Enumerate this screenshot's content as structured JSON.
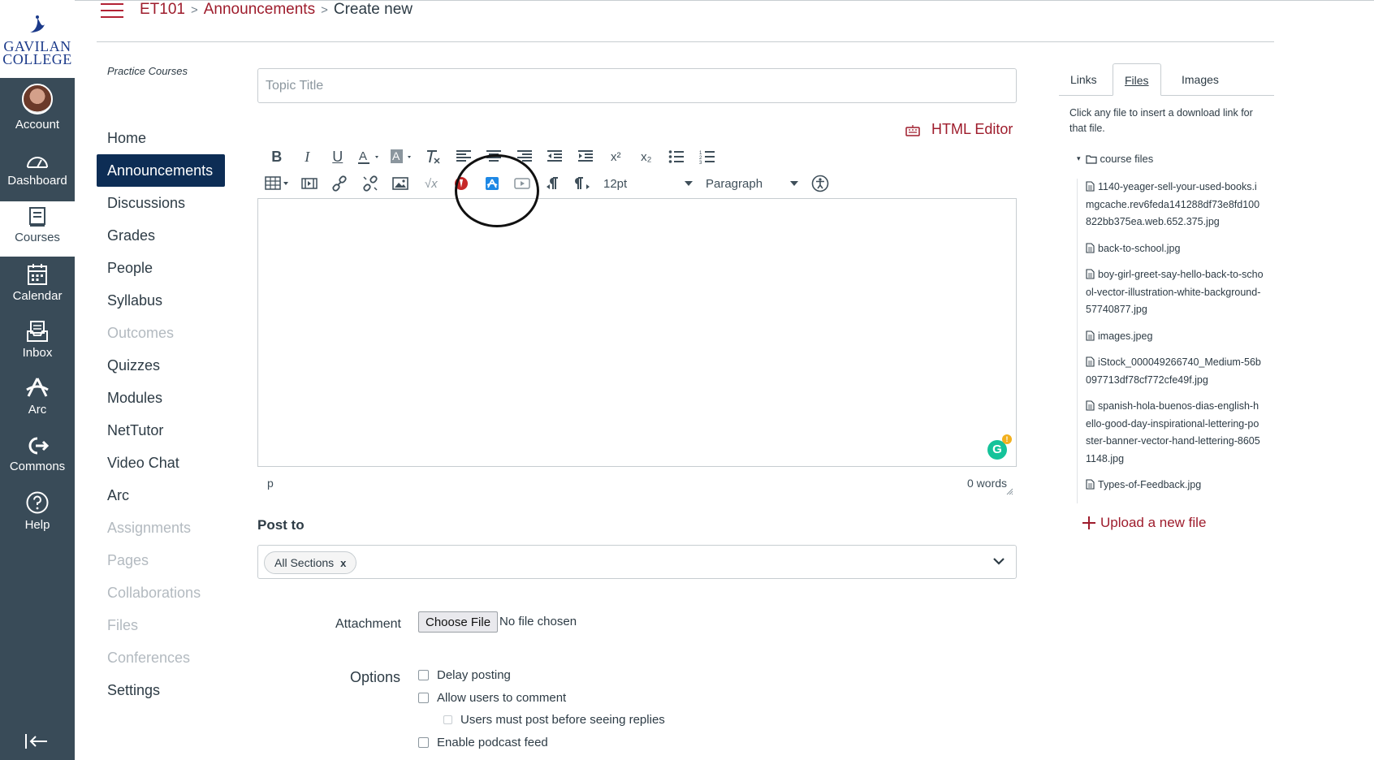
{
  "global_nav": {
    "logo_line1": "GAVILAN",
    "logo_line2": "COLLEGE",
    "items": [
      {
        "label": "Account",
        "icon": "avatar"
      },
      {
        "label": "Dashboard",
        "icon": "dashboard-icon"
      },
      {
        "label": "Courses",
        "icon": "courses-icon"
      },
      {
        "label": "Calendar",
        "icon": "calendar-icon"
      },
      {
        "label": "Inbox",
        "icon": "inbox-icon"
      },
      {
        "label": "Arc",
        "icon": "arc-icon"
      },
      {
        "label": "Commons",
        "icon": "commons-icon"
      },
      {
        "label": "Help",
        "icon": "help-icon"
      }
    ]
  },
  "breadcrumb": {
    "course": "ET101",
    "section": "Announcements",
    "current": "Create new",
    "separator": ">"
  },
  "course_nav": {
    "title": "Practice Courses",
    "items": [
      {
        "label": "Home"
      },
      {
        "label": "Announcements"
      },
      {
        "label": "Discussions"
      },
      {
        "label": "Grades"
      },
      {
        "label": "People"
      },
      {
        "label": "Syllabus"
      },
      {
        "label": "Outcomes"
      },
      {
        "label": "Quizzes"
      },
      {
        "label": "Modules"
      },
      {
        "label": "NetTutor"
      },
      {
        "label": "Video Chat"
      },
      {
        "label": "Arc"
      },
      {
        "label": "Assignments"
      },
      {
        "label": "Pages"
      },
      {
        "label": "Collaborations"
      },
      {
        "label": "Files"
      },
      {
        "label": "Conferences"
      },
      {
        "label": "Settings"
      }
    ]
  },
  "form": {
    "topic_placeholder": "Topic Title",
    "html_editor_label": "HTML Editor",
    "font_size": "12pt",
    "block_format": "Paragraph",
    "status_path": "p",
    "word_count": "0 words",
    "grammarly_letter": "G",
    "grammarly_badge": "!",
    "post_to_label": "Post to",
    "section_chip": "All Sections",
    "chip_remove": "x",
    "attachment_label": "Attachment",
    "choose_file_label": "Choose File",
    "no_file_text": "No file chosen",
    "options_label": "Options",
    "options": {
      "delay_posting": "Delay posting",
      "allow_comment": "Allow users to comment",
      "must_post": "Users must post before seeing replies",
      "podcast_feed": "Enable podcast feed"
    }
  },
  "toolbar": {
    "bold": "B",
    "italic": "I",
    "underline": "U",
    "superscript": "x²",
    "subscript": "x₂",
    "math": "√x"
  },
  "sidebar": {
    "tabs": [
      "Links",
      "Files",
      "Images"
    ],
    "active_tab": "Files",
    "help_text": "Click any file to insert a download link for that file.",
    "folder": "course files",
    "files": [
      "1140-yeager-sell-your-used-books.imgcache.rev6feda141288df73e8fd100822bb375ea.web.652.375.jpg",
      "back-to-school.jpg",
      "boy-girl-greet-say-hello-back-to-school-vector-illustration-white-background-57740877.jpg",
      "images.jpeg",
      "iStock_000049266740_Medium-56b097713df78cf772cfe49f.jpg",
      "spanish-hola-buenos-dias-english-hello-good-day-inspirational-lettering-poster-banner-vector-hand-lettering-86051148.jpg",
      "Types-of-Feedback.jpg"
    ],
    "upload_label": "Upload a new file"
  },
  "colors": {
    "nav_bg": "#394b58",
    "brand_red": "#9e1c2c",
    "active_nav": "#0d2d55",
    "grammarly": "#15c39a"
  }
}
